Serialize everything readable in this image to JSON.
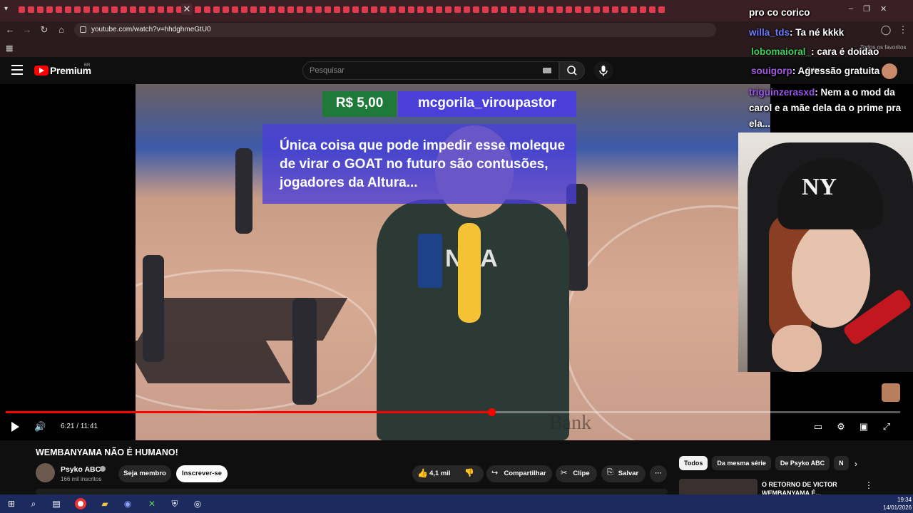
{
  "browser": {
    "url": "youtube.com/watch?v=hhdghmeGtU0",
    "favorites_label": "Todos os favoritos",
    "tab_close": "✕",
    "window_controls": [
      "–",
      "❐",
      "✕"
    ]
  },
  "youtube": {
    "logo_text": "Premium",
    "logo_region": "BR",
    "search_placeholder": "Pesquisar",
    "header_right_text": "Criar"
  },
  "video": {
    "donation": {
      "amount": "R$ 5,00",
      "name": "mcgorila_viroupastor",
      "message": "Única coisa que pode impedir esse moleque de virar o GOAT no futuro são contusões, jogadores da Altura..."
    },
    "overlay_nba_text": "NBA",
    "overlay_bank_text": "Bank",
    "webcam_cap_text": "NY",
    "time_display": "6:21 / 11:41",
    "progress_fraction": 0.543
  },
  "chat": [
    {
      "user": "pro co corico",
      "text": "",
      "color": "#ffffff"
    },
    {
      "user": "willa_tds",
      "text": ": Ta né kkkk",
      "color": "#6e7bff"
    },
    {
      "user": "lobomaioral_",
      "text": ": cara é doidao",
      "color": "#3ccf5a"
    },
    {
      "user": "souigorp",
      "text": ": Agressão gratuita",
      "color": "#a25ae0"
    },
    {
      "user": "triguinzerasxd",
      "text": ": Nem a o mod da carol e a mãe dela da o prime pra ela...",
      "color": "#9b55e8"
    }
  ],
  "below": {
    "title": "WEMBANYAMA NÃO É HUMANO!",
    "channel_name": "Psyko ABC",
    "subscribers": "166 mil inscritos",
    "join_label": "Seja membro",
    "subscribe_label": "Inscrever-se",
    "like_count": "4,1 mil",
    "share_label": "Compartilhar",
    "clip_label": "Clipe",
    "save_label": "Salvar",
    "more_label": "···"
  },
  "sidebar": {
    "chips": [
      "Todos",
      "Da mesma série",
      "De Psyko ABC",
      "N"
    ],
    "rec_title": "O RETORNO DE VICTOR WEMBANYAMA É..."
  },
  "taskbar": {
    "time": "19:34",
    "date": "14/01/2026"
  }
}
